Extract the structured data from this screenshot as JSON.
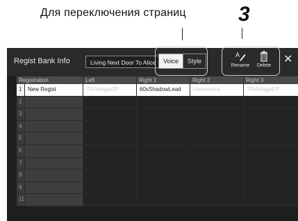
{
  "annotation": {
    "callout": "Для переключения страниц",
    "step_number": "3"
  },
  "window": {
    "title": "Regist Bank Info",
    "song_name": "Living Next Door To Alice",
    "segment": {
      "voice": "Voice",
      "style": "Style",
      "selected": "Voice"
    },
    "tools": {
      "rename": "Rename",
      "delete": "Delete"
    },
    "close_icon": "close-icon"
  },
  "table": {
    "headers": [
      "Registration",
      "Left",
      "Right 1",
      "Right 2",
      "Right 3"
    ],
    "rows": [
      {
        "num": "1",
        "registration": "New Regist",
        "left": "70VintageEP",
        "right1": "60sShadowLead",
        "right2": "Harmonica",
        "right3": "70VintageEP"
      },
      {
        "num": "2"
      },
      {
        "num": "3"
      },
      {
        "num": "4"
      },
      {
        "num": "5"
      },
      {
        "num": "6"
      },
      {
        "num": "7"
      },
      {
        "num": "8"
      },
      {
        "num": "9"
      },
      {
        "num": "10"
      }
    ]
  }
}
